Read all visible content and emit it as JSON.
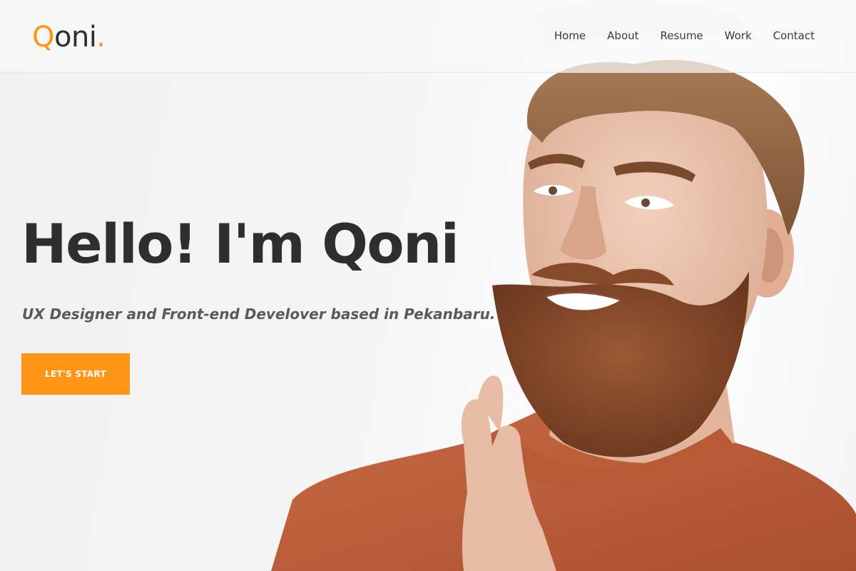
{
  "header": {
    "logo": {
      "main": "oni",
      "accent_letter": "Q",
      "accent_dot": "."
    },
    "nav": [
      {
        "label": "Home"
      },
      {
        "label": "About"
      },
      {
        "label": "Resume"
      },
      {
        "label": "Work"
      },
      {
        "label": "Contact"
      }
    ]
  },
  "hero": {
    "title": "Hello! I'm Qoni",
    "subtitle": "UX Designer and Front-end Develover based in Pekanbaru.",
    "cta_label": "LET'S START",
    "image_subject": "bearded man in orange t-shirt stroking beard"
  },
  "colors": {
    "accent": "#ff9514",
    "text_dark": "#2e2e2e",
    "text_muted": "#5a5a5a",
    "background": "#f4f4f4"
  }
}
